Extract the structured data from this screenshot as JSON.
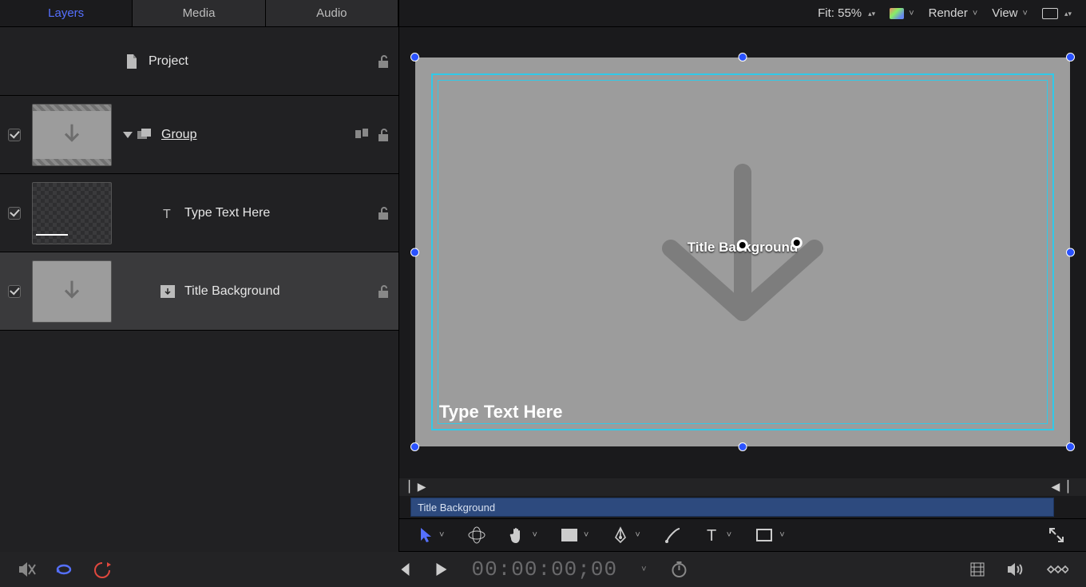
{
  "tabs": {
    "layers": "Layers",
    "media": "Media",
    "audio": "Audio"
  },
  "layers": {
    "project": "Project",
    "group": "Group",
    "text_layer": "Type Text Here",
    "title_bg": "Title Background"
  },
  "viewer": {
    "fit_label": "Fit: 55%",
    "render": "Render",
    "view": "View",
    "placeholder_text": "Type Text Here",
    "center_label": "Title Background"
  },
  "mini_timeline": {
    "clip_name": "Title Background"
  },
  "transport": {
    "timecode": "00:00:00;00"
  }
}
